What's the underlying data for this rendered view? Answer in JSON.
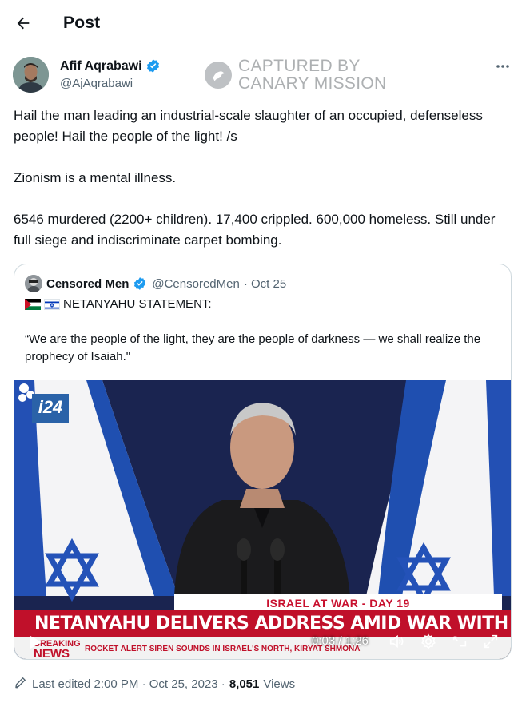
{
  "header": {
    "title": "Post"
  },
  "author": {
    "name": "Afif Aqrabawi",
    "handle": "@AjAqrabawi"
  },
  "watermark": {
    "line1": "CAPTURED BY",
    "line2": "CANARY MISSION"
  },
  "post": {
    "paragraphs": [
      "Hail the man leading an industrial-scale slaughter of an occupied, defenseless people! Hail the people of the light! /s",
      "Zionism is a mental illness.",
      "6546 murdered (2200+ children). 17,400 crippled. 600,000 homeless. Still under full siege and indiscriminate carpet bombing."
    ]
  },
  "quote": {
    "name": "Censored Men",
    "handle": "@CensoredMen",
    "date": "· Oct 25",
    "statement_title": "NETANYAHU STATEMENT:",
    "quote_text": "“We are the people of the light, they are the people of darkness — we shall realize the prophecy of Isaiah.\""
  },
  "video": {
    "channel_logo": "i24",
    "ticker_top": "ISRAEL AT WAR - DAY 19",
    "ticker_main": "NETANYAHU DELIVERS ADDRESS AMID WAR WITH HAMAS",
    "ticker_bottom": "ROCKET ALERT SIREN SOUNDS IN ISRAEL'S NORTH, KIRYAT SHMONA",
    "breaking_line1": "BREAKING",
    "breaking_line2": "NEWS",
    "time_display": "0:03 / 1:26"
  },
  "footer": {
    "edited_label": "Last edited 2:00 PM · Oct 25, 2023 ·",
    "views_count": "8,051",
    "views_label": "Views"
  },
  "colors": {
    "verified_blue": "#1d9bf0",
    "ticker_red": "#c0102a",
    "flag_blue": "#0038b8"
  }
}
